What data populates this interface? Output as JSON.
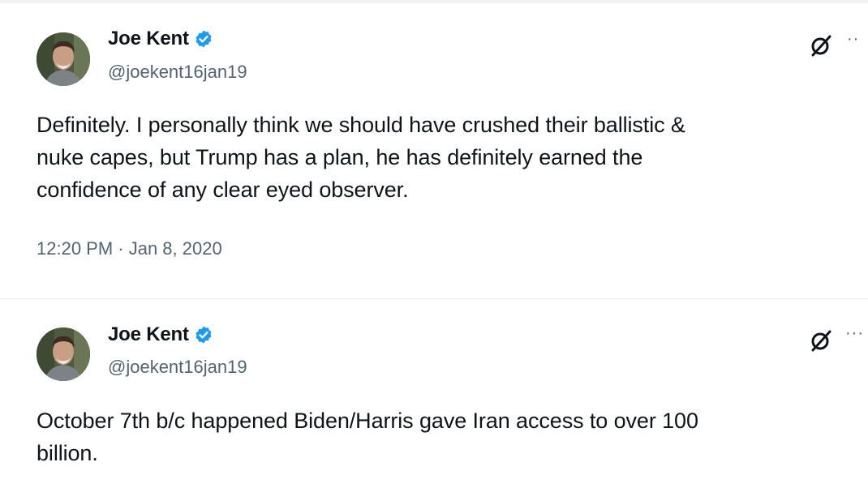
{
  "tweets": [
    {
      "author": {
        "name": "Joe Kent",
        "handle": "@joekent16jan19",
        "verified": true
      },
      "text": "Definitely. I personally think we should have crushed their ballistic &\nnuke capes, but Trump has a plan, he has definitely earned the\nconfidence of any clear eyed observer.",
      "timestamp": "12:20 PM · Jan 8, 2020",
      "icons": [
        "grok-icon",
        "more-icon"
      ]
    },
    {
      "author": {
        "name": "Joe Kent",
        "handle": "@joekent16jan19",
        "verified": true
      },
      "text": "October 7th b/c happened Biden/Harris gave Iran access to over 100\nbillion.",
      "icons": [
        "grok-icon",
        "more-icon"
      ]
    }
  ],
  "colors": {
    "verified_blue": "#1d9bf0",
    "secondary_text": "#536471"
  }
}
